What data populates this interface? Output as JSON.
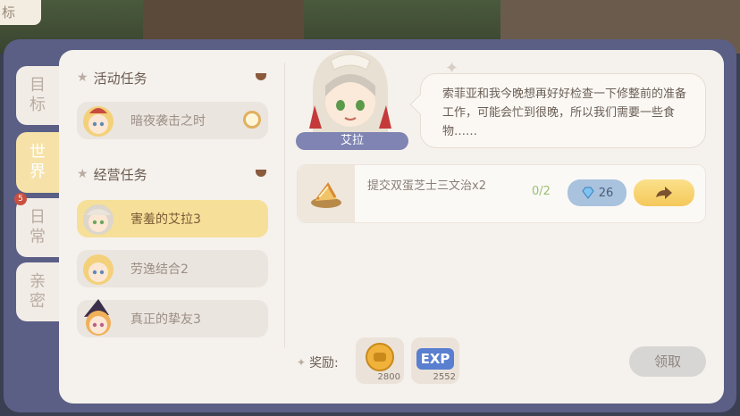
{
  "corner_tab": "标",
  "side_tabs": [
    {
      "label": "目\n标",
      "active": false,
      "badge": ""
    },
    {
      "label": "世\n界",
      "active": true,
      "badge": ""
    },
    {
      "label": "日\n常",
      "active": false,
      "badge": "5"
    },
    {
      "label": "亲\n密",
      "active": false,
      "badge": ""
    }
  ],
  "sections": {
    "event": {
      "title": "活动任务",
      "tasks": [
        {
          "label": "暗夜袭击之时",
          "active": false
        }
      ]
    },
    "business": {
      "title": "经营任务",
      "tasks": [
        {
          "label": "害羞的艾拉3",
          "active": true
        },
        {
          "label": "劳逸结合2",
          "active": false
        },
        {
          "label": "真正的挚友3",
          "active": false
        }
      ]
    }
  },
  "npc": {
    "name": "艾拉",
    "dialogue": "索菲亚和我今晚想再好好检查一下修整前的准备工作，可能会忙到很晚，所以我们需要一些食物……"
  },
  "requirement": {
    "desc": "提交双蛋芝士三文治x2",
    "progress": "0/2",
    "gem_cost": "26"
  },
  "rewards": {
    "label": "奖励:",
    "items": [
      {
        "icon": "coin-icon",
        "amount": "2800"
      },
      {
        "icon": "exp-icon",
        "text": "EXP",
        "amount": "2552"
      }
    ]
  },
  "claim_button": "领取",
  "colors": {
    "accent": "#f6df98",
    "frame": "#5b5f86",
    "nameplate": "#7f84b3"
  }
}
